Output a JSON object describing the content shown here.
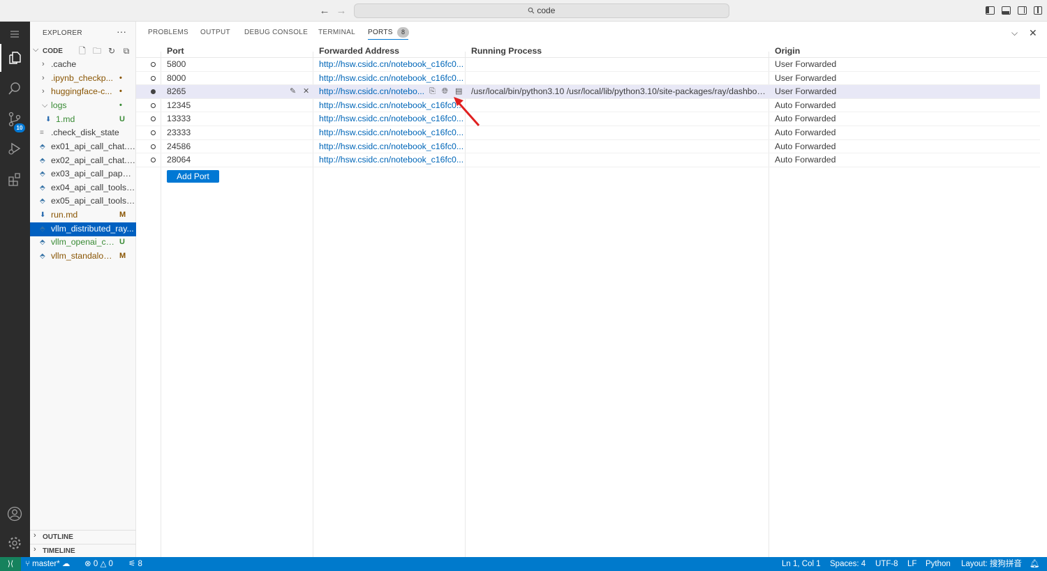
{
  "titlebar": {
    "back_icon": "arrow-left-icon",
    "forward_icon": "arrow-right-icon",
    "search_text": "code"
  },
  "activity_bar": {
    "items": [
      "menu-icon",
      "files-icon",
      "search-icon",
      "source-control-icon",
      "run-debug-icon",
      "extensions-icon",
      "account-icon",
      "settings-gear-icon"
    ],
    "scm_badge": "10"
  },
  "sidebar": {
    "title": "EXPLORER",
    "more": "···",
    "folder": "CODE",
    "items": [
      {
        "label": ".cache",
        "color": "#3b3b3b",
        "decoration": ""
      },
      {
        "label": ".ipynb_checkp...",
        "color": "#895503",
        "decoration": "•"
      },
      {
        "label": "huggingface-c...",
        "color": "#895503",
        "decoration": "•"
      },
      {
        "label": "logs",
        "color": "#388a34",
        "decoration": "•"
      },
      {
        "label": "1.md",
        "color": "#388a34",
        "decoration": "U"
      },
      {
        "label": ".check_disk_state",
        "color": "#3b3b3b",
        "decoration": ""
      },
      {
        "label": "ex01_api_call_chat.py",
        "color": "#3b3b3b",
        "decoration": ""
      },
      {
        "label": "ex02_api_call_chat.py",
        "color": "#3b3b3b",
        "decoration": ""
      },
      {
        "label": "ex03_api_call_paper...",
        "color": "#3b3b3b",
        "decoration": ""
      },
      {
        "label": "ex04_api_call_tools....",
        "color": "#3b3b3b",
        "decoration": ""
      },
      {
        "label": "ex05_api_call_tools....",
        "color": "#3b3b3b",
        "decoration": ""
      },
      {
        "label": "run.md",
        "color": "#895503",
        "decoration": "M"
      },
      {
        "label": "vllm_distributed_ray...",
        "color": "#ffffff",
        "decoration": ""
      },
      {
        "label": "vllm_openai_ca...",
        "color": "#388a34",
        "decoration": "U"
      },
      {
        "label": "vllm_standalon...",
        "color": "#895503",
        "decoration": "M"
      }
    ],
    "outline": "OUTLINE",
    "timeline": "TIMELINE"
  },
  "panel": {
    "tabs": [
      "PROBLEMS",
      "OUTPUT",
      "DEBUG CONSOLE",
      "TERMINAL",
      "PORTS"
    ],
    "ports_count": "8",
    "columns": [
      "Port",
      "Forwarded Address",
      "Running Process",
      "Origin"
    ],
    "rows": [
      {
        "port": "5800",
        "address": "http://hsw.csidc.cn/notebook_c16fc0...",
        "process": "",
        "origin": "User Forwarded"
      },
      {
        "port": "8000",
        "address": "http://hsw.csidc.cn/notebook_c16fc0...",
        "process": "",
        "origin": "User Forwarded"
      },
      {
        "port": "8265",
        "address": "http://hsw.csidc.cn/notebo...",
        "process": "/usr/local/bin/python3.10 /usr/local/lib/python3.10/site-packages/ray/dashboa...",
        "origin": "User Forwarded"
      },
      {
        "port": "12345",
        "address": "http://hsw.csidc.cn/notebook_c16fc0...",
        "process": "",
        "origin": "Auto Forwarded"
      },
      {
        "port": "13333",
        "address": "http://hsw.csidc.cn/notebook_c16fc0...",
        "process": "",
        "origin": "Auto Forwarded"
      },
      {
        "port": "23333",
        "address": "http://hsw.csidc.cn/notebook_c16fc0...",
        "process": "",
        "origin": "Auto Forwarded"
      },
      {
        "port": "24586",
        "address": "http://hsw.csidc.cn/notebook_c16fc0...",
        "process": "",
        "origin": "Auto Forwarded"
      },
      {
        "port": "28064",
        "address": "http://hsw.csidc.cn/notebook_c16fc0...",
        "process": "",
        "origin": "Auto Forwarded"
      }
    ],
    "add_port": "Add Port"
  },
  "statusbar": {
    "branch": "master*",
    "errors": "0",
    "warnings": "0",
    "ports": "8",
    "position": "Ln 1, Col 1",
    "spaces": "Spaces: 4",
    "encoding": "UTF-8",
    "eol": "LF",
    "language": "Python",
    "layout": "Layout: 搜狗拼音"
  },
  "colors": {
    "accent": "#0078d4",
    "statusbar": "#007acc",
    "remote": "#16825d",
    "modified": "#895503",
    "untracked": "#388a34",
    "link": "#0066b8",
    "annotation_arrow": "#e02020"
  }
}
